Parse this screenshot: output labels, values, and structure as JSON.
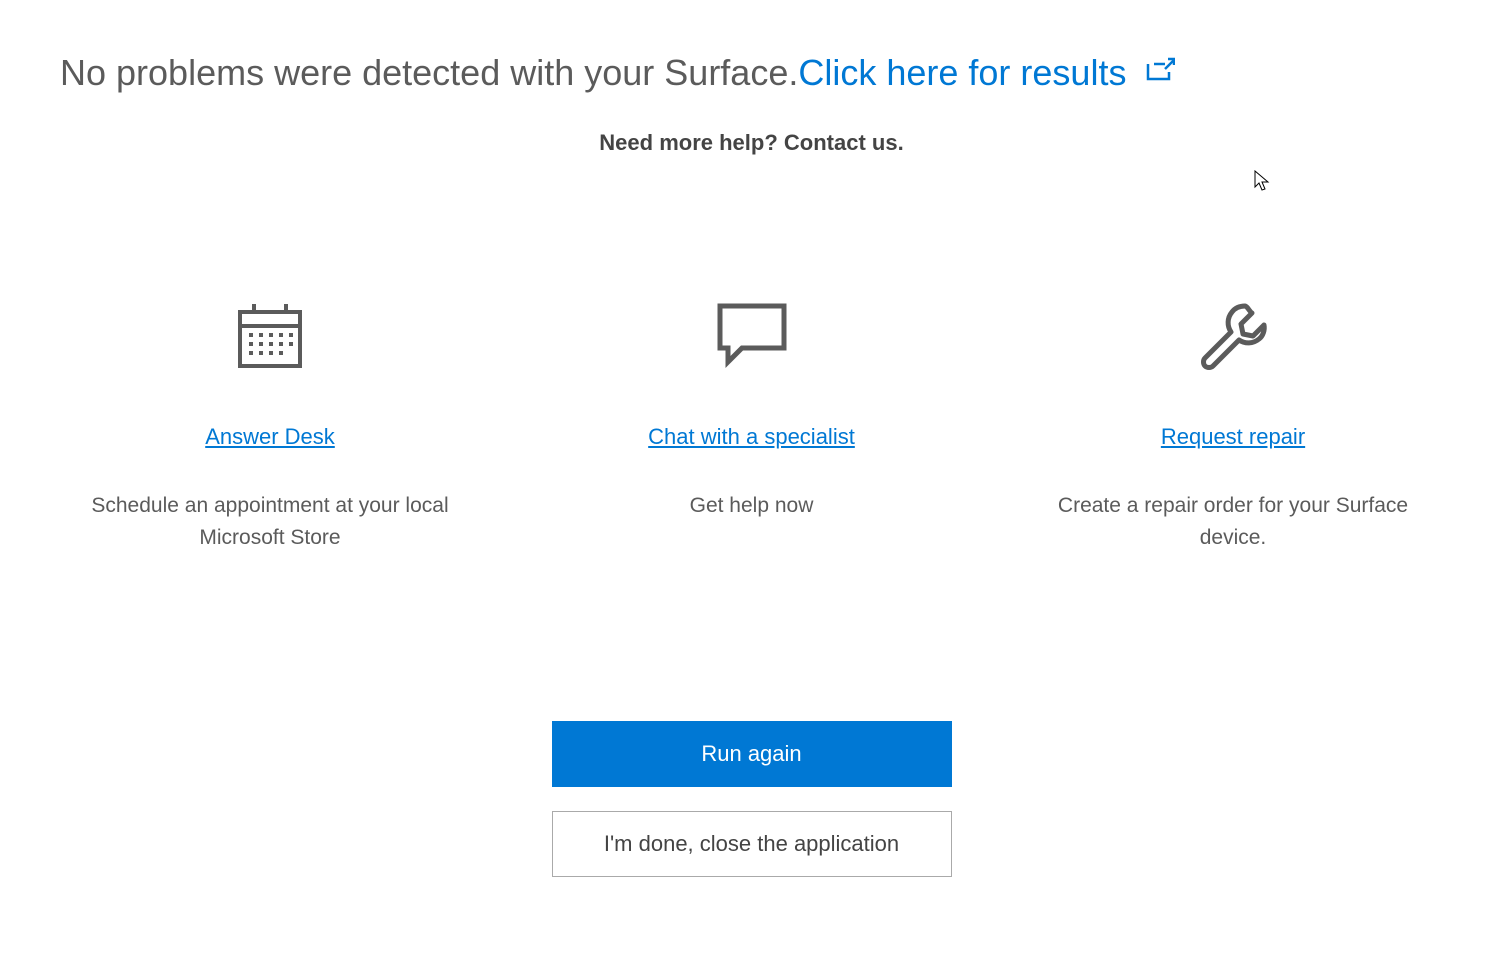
{
  "header": {
    "heading": "No problems were detected with your Surface.",
    "results_link": "Click here for results"
  },
  "subhead": "Need more help? Contact us.",
  "cards": [
    {
      "icon": "calendar-icon",
      "link_label": "Answer Desk",
      "description": "Schedule an appointment at your local Microsoft Store"
    },
    {
      "icon": "chat-icon",
      "link_label": "Chat with a specialist",
      "description": "Get help now"
    },
    {
      "icon": "wrench-icon",
      "link_label": "Request repair",
      "description": "Create a repair order for your Surface device."
    }
  ],
  "buttons": {
    "primary": "Run again",
    "secondary": "I'm done, close the application"
  },
  "colors": {
    "link": "#0078D4",
    "primary_btn": "#0078D4",
    "text": "#5b5b5b"
  }
}
